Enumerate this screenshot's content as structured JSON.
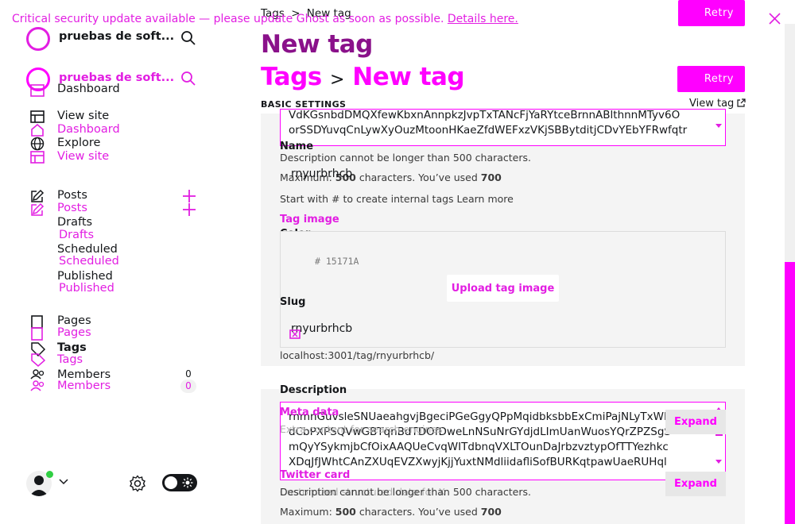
{
  "banner": {
    "text": "Critical security update available — please update Ghost as soon as possible.",
    "link": "Details here."
  },
  "sidebar": {
    "site_title": "pruebas de soft...",
    "site_title_2": "pruebas de soft...",
    "nav": {
      "dashboard": "Dashboard",
      "view_site": "View site",
      "dashboard_2": "Dashboard",
      "explore": "Explore",
      "view_site_2": "View site"
    },
    "posts": {
      "label": "Posts",
      "label_2": "Posts",
      "drafts": "Drafts",
      "drafts_2": "Drafts",
      "scheduled": "Scheduled",
      "scheduled_2": "Scheduled",
      "published": "Published",
      "published_2": "Published"
    },
    "pages": {
      "label": "Pages",
      "label_2": "Pages"
    },
    "tags": {
      "label": "Tags",
      "label_2": "Tags"
    },
    "members": {
      "label": "Members",
      "label_2": "Members",
      "count": "0",
      "count_2": "0"
    }
  },
  "header": {
    "breadcrumb_parent": "Tags",
    "breadcrumb_sep": ">",
    "breadcrumb_current": "New tag",
    "title": "New tag",
    "title2_parent": "Tags",
    "title2_sep": ">",
    "title2_current": "New tag",
    "retry_label": "Retry",
    "retry_label_2": "Retry"
  },
  "settings": {
    "section_title": "BASIC SETTINGS",
    "view_tag": "View tag",
    "top_textarea_lines": [
      "VdKGsnbdDMQXfewKbxnAnnpkzJvpTxTANcFjYaRYtceBrnnABlthnnMTyv6O",
      "orSSDYuvqCnLywXyOuzMtoonHKaeZfdWEFxzVKjSBBytditjCDvYEbYFRwfqtr"
    ],
    "name_label": "Name",
    "desc_error": "Description cannot be longer than 500 characters.",
    "max_prefix": "Maximum: ",
    "max_value": "500",
    "used_text": " characters. You’ve used ",
    "used_value": "700",
    "name_value": "rnyurbrhcb",
    "start_hint": "Start with # to create internal tags ",
    "learn_more": "Learn more",
    "tag_image_label": "Tag image",
    "color_label": "Color",
    "color_value": "# 15171A",
    "upload_label": "Upload tag image",
    "slug_label": "Slug",
    "slug_value": "rnyurbrhcb",
    "slug_url": "localhost:3001/tag/rnyurbrhcb/",
    "description_label": "Description",
    "description_lines": [
      "rnmnGuvsleSNUaeahgvjBgeciPGeGgyQPpMqidbksbbExCmiPajNLyTxWH",
      "dCbPXPSQVwGBTqnBdTDOfDweLnNSuNrGYdjdLImUanWuosYQrZPZSgS",
      "mQyYSykmjbCfOixAAQUeCvqWITdbnqVXLTOunDaJrbzvztypOfTTYezhkc",
      "XDqJfJWhtCAnZXUqEVZXwyjKjjYuxtNMdliidafliSofBURKqtpawUaeRUHql"
    ],
    "meta_label": "Meta data",
    "meta_hint": "Extra content for search engines",
    "expand_label": "Expand",
    "twitter_label": "Twitter card",
    "twitter_hint": "Customized structured data for X",
    "expand_label_2": "Expand",
    "desc_error_2": "Description cannot be longer than 500 characters.",
    "max_prefix_2": "Maximum: ",
    "max_value_2": "500",
    "used_text_2": " characters. You’ve used ",
    "used_value_2": "700"
  },
  "colors": {
    "accent": "#ff00ff",
    "accent_text": "#e21ee2",
    "title_purple": "#8a118a",
    "panel": "#f4f4f4",
    "dark": "#15171A"
  }
}
